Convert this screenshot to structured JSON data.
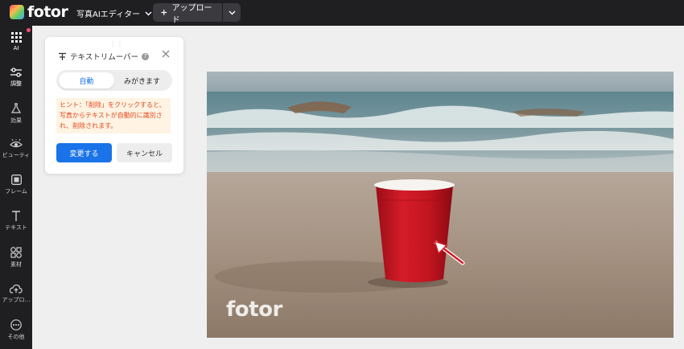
{
  "app": {
    "logo_text": "fotor"
  },
  "header": {
    "editor_menu_label": "写真AIエディター",
    "upload_label": "アップロード"
  },
  "sidebar": {
    "items": [
      {
        "label": "AI",
        "icon": "grid-icon"
      },
      {
        "label": "調整",
        "icon": "sliders-icon"
      },
      {
        "label": "効果",
        "icon": "flask-icon"
      },
      {
        "label": "ビューティ",
        "icon": "eye-icon"
      },
      {
        "label": "フレーム",
        "icon": "frame-icon"
      },
      {
        "label": "テキスト",
        "icon": "text-icon"
      },
      {
        "label": "素材",
        "icon": "shapes-icon"
      },
      {
        "label": "アップロ…",
        "icon": "cloud-upload-icon"
      },
      {
        "label": "その他",
        "icon": "more-icon"
      }
    ]
  },
  "panel": {
    "title": "テキストリムーバー",
    "mode_options": [
      "自動",
      "みがきます"
    ],
    "selected_mode": "自動",
    "hint_lines": [
      "ヒント：「削除」をクリックすると、",
      "写真からテキストが自動的に識別さ",
      "れ、削除されます。"
    ],
    "apply_label": "変更する",
    "cancel_label": "キャンセル"
  },
  "canvas": {
    "watermark_text": "fotor"
  },
  "colors": {
    "accent": "#1a73e8",
    "hint_text": "#e24a1d",
    "hint_bg": "#fff3e3",
    "sidebar_bg": "#1f1f22",
    "notification_dot": "#ff4d6d"
  }
}
